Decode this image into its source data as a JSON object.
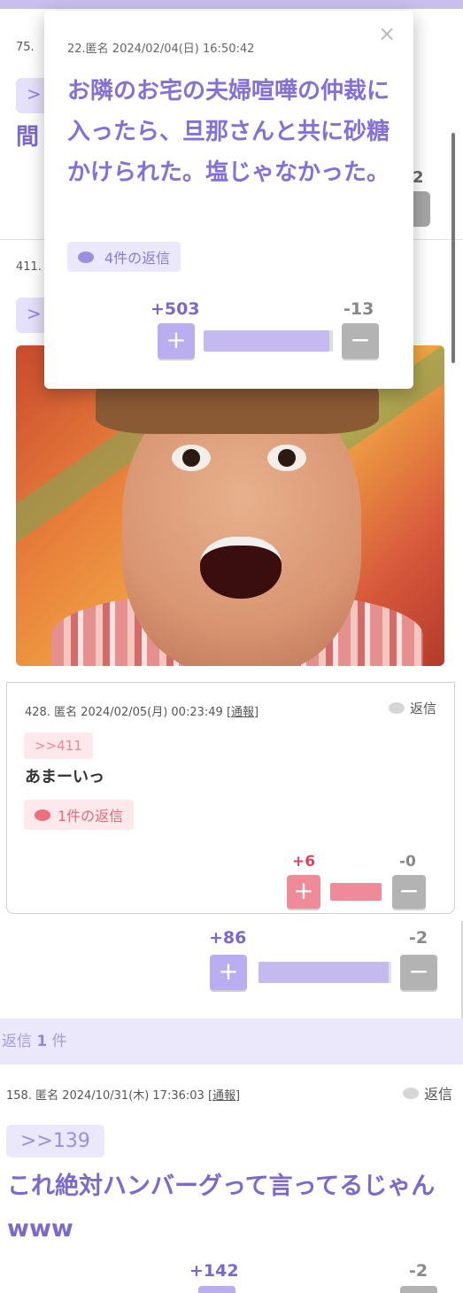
{
  "background": {
    "comment_75": {
      "meta_prefix": "75.",
      "anchor": ">",
      "text_fragment": "間",
      "minus_count": "2"
    },
    "comment_411": {
      "meta_prefix": "411.",
      "anchor": ">"
    }
  },
  "popup": {
    "meta": "22.匿名 2024/02/04(日) 16:50:42",
    "close_icon": "×",
    "body": "お隣のお宅の夫婦喧嘩の仲裁に入ったら、旦那さんと共に砂糖かけられた。塩じゃなかった。",
    "replies_label": "4件の返信",
    "plus_count": "+503",
    "minus_count": "-13",
    "plus_label": "+",
    "minus_label": "−",
    "plus_share": 0.975
  },
  "reply_428": {
    "meta": "428. 匿名 2024/02/05(月) 00:23:49",
    "report": "[通報]",
    "reply_action": "返信",
    "anchor": ">>411",
    "text": "あまーいっ",
    "replies_label": "1件の返信",
    "plus_count": "+6",
    "minus_count": "-0",
    "plus_label": "+",
    "minus_label": "−",
    "plus_share": 1.0
  },
  "comment_411_votes": {
    "plus_count": "+86",
    "minus_count": "-2",
    "plus_label": "+",
    "minus_label": "−",
    "plus_share": 0.977
  },
  "section": {
    "prefix": "返信 ",
    "count": "1",
    "suffix": " 件"
  },
  "comment_158": {
    "meta": "158. 匿名 2024/10/31(木) 17:36:03",
    "report": "[通報]",
    "reply_action": "返信",
    "anchor": ">>139",
    "text": "これ絶対ハンバーグって言ってるじゃんwww",
    "plus_count": "+142",
    "minus_count": "-2"
  },
  "colors": {
    "accent_purple": "#8470d6",
    "vote_purple": "#bbaef0",
    "vote_grey": "#b3b3b3",
    "vote_pink": "#ef8b98",
    "top_bar": "#c9bfee"
  }
}
